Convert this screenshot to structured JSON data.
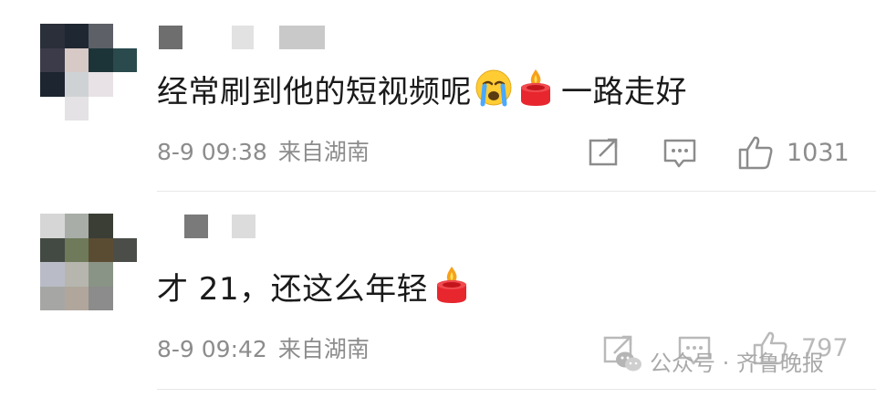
{
  "comments": [
    {
      "text": "经常刷到他的短视频呢",
      "after_emoji_text": "一路走好",
      "emojis": [
        "crying-face",
        "candle"
      ],
      "date": "8-9 09:38",
      "location": "来自湖南",
      "likes": "1031"
    },
    {
      "text": "才 21，还这么年轻",
      "emojis": [
        "candle"
      ],
      "date": "8-9 09:42",
      "location": "来自湖南",
      "likes": "797"
    }
  ],
  "watermark": {
    "text": "公众号 · 齐鲁晚报"
  },
  "colors": {
    "meta_text": "#8c8c8c",
    "divider": "#e8e8e8",
    "candle_red": "#e8262e",
    "flame_orange": "#f7a11a",
    "emoji_yellow": "#ffcc33"
  }
}
